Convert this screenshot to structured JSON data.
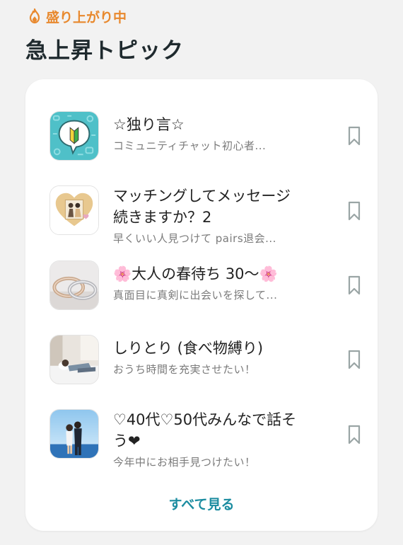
{
  "header": {
    "trend_label": "盛り上がり中",
    "title": "急上昇トピック"
  },
  "topics": [
    {
      "title": "☆独り言☆",
      "subtitle": "コミュニティチャット初心者...",
      "icon": "beginner-mark-icon"
    },
    {
      "title": "マッチングしてメッセージ続きますか？2",
      "subtitle": "早くいい人見つけて pairs退会...",
      "icon": "couple-heart-photo"
    },
    {
      "title": "🌸大人の春待ち 30～🌸",
      "subtitle": "真面目に真剣に出会いを探して...",
      "icon": "wedding-rings-photo"
    },
    {
      "title": "しりとり (食べ物縛り)",
      "subtitle": "おうち時間を充実させたい！",
      "icon": "relaxing-bed-photo"
    },
    {
      "title": "♡40代♡50代みんなで話そう❤",
      "subtitle": "今年中にお相手見つけたい！",
      "icon": "couple-beach-photo"
    }
  ],
  "footer": {
    "see_all": "すべて見る"
  },
  "colors": {
    "accent_orange": "#e8892e",
    "link_teal": "#1b8ca0",
    "bookmark_gray": "#9aa5a5"
  }
}
